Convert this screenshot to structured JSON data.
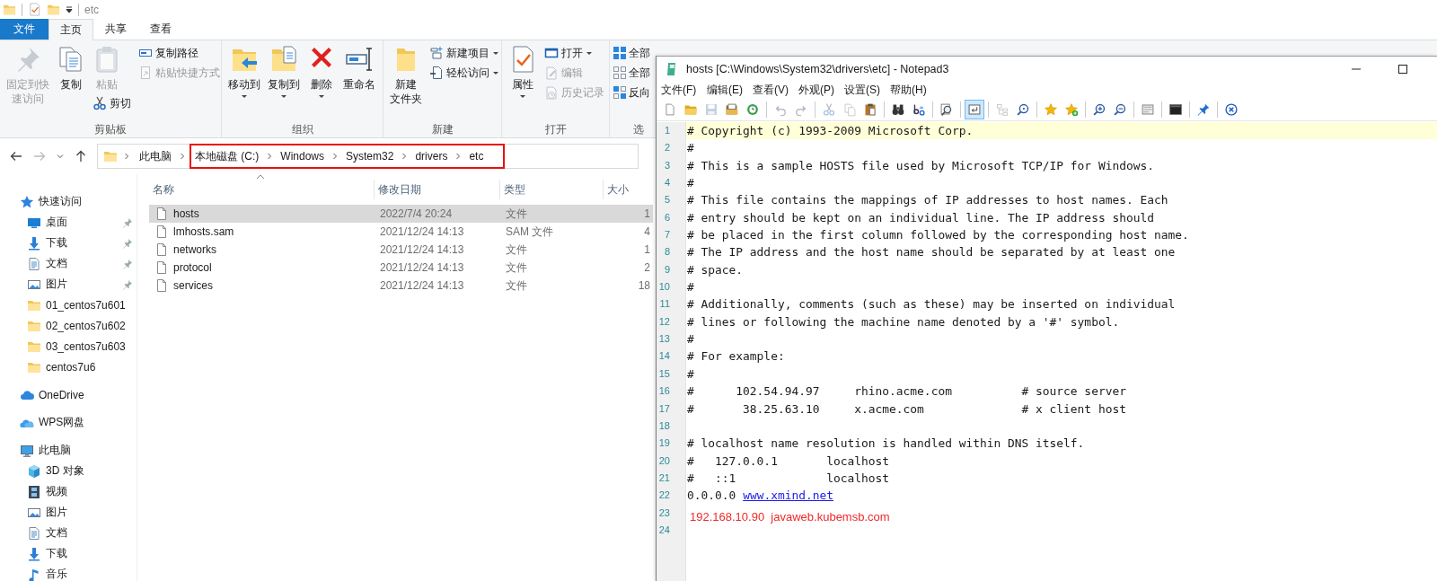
{
  "explorer": {
    "title": "etc",
    "tabs": [
      {
        "label": "文件",
        "kind": "file",
        "selected": false
      },
      {
        "label": "主页",
        "kind": "tab",
        "selected": true
      },
      {
        "label": "共享",
        "kind": "tab",
        "selected": false
      },
      {
        "label": "查看",
        "kind": "tab",
        "selected": false
      }
    ],
    "ribbon": [
      {
        "label": "剪贴板",
        "columns": [
          [
            {
              "label": "固定到快",
              "label_line2": "速访问",
              "kind": "pin",
              "large": true,
              "disabled": true,
              "dropdown": false
            }
          ],
          [
            {
              "label": "复制",
              "kind": "copy",
              "large": true,
              "disabled": false,
              "dropdown": false
            }
          ],
          [
            {
              "label": "粘贴",
              "kind": "paste",
              "large": true,
              "disabled": true,
              "dropdown": false
            },
            {
              "label": "剪切",
              "kind": "cut",
              "large": false,
              "disabled": false,
              "dropdown": false
            }
          ],
          [
            {
              "label": "复制路径",
              "kind": "copy-path",
              "large": false,
              "disabled": false,
              "dropdown": false
            },
            {
              "label": "粘贴快捷方式",
              "kind": "paste-shortcut",
              "large": false,
              "disabled": true,
              "dropdown": false
            }
          ]
        ]
      },
      {
        "label": "组织",
        "columns": [
          [
            {
              "label": "移动到",
              "kind": "move",
              "large": true,
              "disabled": false,
              "dropdown": true
            }
          ],
          [
            {
              "label": "复制到",
              "kind": "copyto",
              "large": true,
              "disabled": false,
              "dropdown": true
            }
          ],
          [
            {
              "label": "删除",
              "kind": "delete",
              "large": true,
              "disabled": false,
              "dropdown": true
            }
          ],
          [
            {
              "label": "重命名",
              "kind": "rename",
              "large": true,
              "disabled": false,
              "dropdown": false
            }
          ]
        ]
      },
      {
        "label": "新建",
        "columns": [
          [
            {
              "label": "新建",
              "label_line2": "文件夹",
              "kind": "new-folder",
              "large": true,
              "disabled": false,
              "dropdown": false
            }
          ],
          [
            {
              "label": "新建项目",
              "kind": "new-item",
              "large": false,
              "disabled": false,
              "dropdown": true
            },
            {
              "label": "轻松访问",
              "kind": "easy-access",
              "large": false,
              "disabled": false,
              "dropdown": true
            }
          ]
        ]
      },
      {
        "label": "打开",
        "columns": [
          [
            {
              "label": "属性",
              "kind": "properties",
              "large": true,
              "disabled": false,
              "dropdown": true
            }
          ],
          [
            {
              "label": "打开",
              "kind": "open",
              "large": false,
              "disabled": false,
              "dropdown": true
            },
            {
              "label": "编辑",
              "kind": "edit",
              "large": false,
              "disabled": true,
              "dropdown": false
            },
            {
              "label": "历史记录",
              "kind": "history",
              "large": false,
              "disabled": true,
              "dropdown": false
            }
          ]
        ]
      },
      {
        "label": "选",
        "columns": [
          [
            {
              "label": "全部",
              "kind": "select-all",
              "large": false,
              "disabled": false,
              "dropdown": false
            },
            {
              "label": "全部",
              "kind": "select-none",
              "large": false,
              "disabled": false,
              "dropdown": false
            },
            {
              "label": "反向",
              "kind": "invert",
              "large": false,
              "disabled": false,
              "dropdown": false
            }
          ]
        ]
      }
    ],
    "breadcrumbs": [
      {
        "label": "此电脑",
        "highlighted": false
      },
      {
        "label": "本地磁盘 (C:)",
        "highlighted": true
      },
      {
        "label": "Windows",
        "highlighted": true
      },
      {
        "label": "System32",
        "highlighted": true
      },
      {
        "label": "drivers",
        "highlighted": true
      },
      {
        "label": "etc",
        "highlighted": true
      }
    ],
    "sidebar": [
      {
        "label": "快速访问",
        "kind": "star",
        "children": [
          {
            "label": "桌面",
            "kind": "desktop",
            "pinned": true
          },
          {
            "label": "下载",
            "kind": "download",
            "pinned": true
          },
          {
            "label": "文档",
            "kind": "document",
            "pinned": true
          },
          {
            "label": "图片",
            "kind": "picture",
            "pinned": true
          },
          {
            "label": "01_centos7u601",
            "kind": "folder",
            "pinned": false
          },
          {
            "label": "02_centos7u602",
            "kind": "folder",
            "pinned": false
          },
          {
            "label": "03_centos7u603",
            "kind": "folder",
            "pinned": false
          },
          {
            "label": "centos7u6",
            "kind": "folder",
            "pinned": false
          }
        ]
      },
      {
        "label": "OneDrive",
        "kind": "cloud"
      },
      {
        "label": "WPS网盘",
        "kind": "cloud-wps"
      },
      {
        "label": "此电脑",
        "kind": "computer",
        "children": [
          {
            "label": "3D 对象",
            "kind": "cube"
          },
          {
            "label": "视频",
            "kind": "film"
          },
          {
            "label": "图片",
            "kind": "picture"
          },
          {
            "label": "文档",
            "kind": "document"
          },
          {
            "label": "下载",
            "kind": "download"
          },
          {
            "label": "音乐",
            "kind": "music"
          }
        ]
      }
    ],
    "columns": [
      "名称",
      "修改日期",
      "类型",
      "大小"
    ],
    "files": [
      {
        "name": "hosts",
        "date": "2022/7/4 20:24",
        "type": "文件",
        "size": "1",
        "selected": true
      },
      {
        "name": "lmhosts.sam",
        "date": "2021/12/24 14:13",
        "type": "SAM 文件",
        "size": "4",
        "selected": false
      },
      {
        "name": "networks",
        "date": "2021/12/24 14:13",
        "type": "文件",
        "size": "1",
        "selected": false
      },
      {
        "name": "protocol",
        "date": "2021/12/24 14:13",
        "type": "文件",
        "size": "2",
        "selected": false
      },
      {
        "name": "services",
        "date": "2021/12/24 14:13",
        "type": "文件",
        "size": "18",
        "selected": false
      }
    ]
  },
  "notepad": {
    "title": "hosts [C:\\Windows\\System32\\drivers\\etc] - Notepad3",
    "menu": [
      "文件(F)",
      "编辑(E)",
      "查看(V)",
      "外观(P)",
      "设置(S)",
      "帮助(H)"
    ],
    "toolbar": [
      {
        "kind": "new",
        "disabled": false,
        "on": false
      },
      {
        "kind": "open",
        "disabled": false,
        "on": false
      },
      {
        "kind": "save",
        "disabled": true,
        "on": false
      },
      {
        "kind": "saveas",
        "disabled": false,
        "on": false
      },
      {
        "kind": "revert",
        "disabled": false,
        "on": false
      },
      {
        "kind": "separator"
      },
      {
        "kind": "undo",
        "disabled": true,
        "on": false
      },
      {
        "kind": "redo",
        "disabled": true,
        "on": false
      },
      {
        "kind": "separator"
      },
      {
        "kind": "cut",
        "disabled": true,
        "on": false
      },
      {
        "kind": "copy",
        "disabled": true,
        "on": false
      },
      {
        "kind": "paste",
        "disabled": false,
        "on": false
      },
      {
        "kind": "separator"
      },
      {
        "kind": "find",
        "disabled": false,
        "on": false
      },
      {
        "kind": "replace",
        "disabled": false,
        "on": false
      },
      {
        "kind": "separator"
      },
      {
        "kind": "goto",
        "disabled": false,
        "on": false
      },
      {
        "kind": "separator"
      },
      {
        "kind": "wrap",
        "disabled": false,
        "on": true
      },
      {
        "kind": "separator"
      },
      {
        "kind": "tree",
        "disabled": true,
        "on": false
      },
      {
        "kind": "zoom-find",
        "disabled": false,
        "on": false
      },
      {
        "kind": "separator"
      },
      {
        "kind": "star",
        "disabled": false,
        "on": false
      },
      {
        "kind": "star-add",
        "disabled": false,
        "on": false
      },
      {
        "kind": "separator"
      },
      {
        "kind": "zoom-in",
        "disabled": false,
        "on": false
      },
      {
        "kind": "zoom-out",
        "disabled": false,
        "on": false
      },
      {
        "kind": "separator"
      },
      {
        "kind": "view",
        "disabled": false,
        "on": false
      },
      {
        "kind": "separator"
      },
      {
        "kind": "terminal",
        "disabled": false,
        "on": false
      },
      {
        "kind": "separator"
      },
      {
        "kind": "pin",
        "disabled": false,
        "on": false
      },
      {
        "kind": "separator"
      },
      {
        "kind": "close",
        "disabled": false,
        "on": false
      }
    ],
    "lines": [
      {
        "number": "1",
        "kind": "code",
        "current": true,
        "text": "# Copyright (c) 1993-2009 Microsoft Corp."
      },
      {
        "number": "2",
        "kind": "code",
        "current": false,
        "text": "#"
      },
      {
        "number": "3",
        "kind": "code",
        "current": false,
        "text": "# This is a sample HOSTS file used by Microsoft TCP/IP for Windows."
      },
      {
        "number": "4",
        "kind": "code",
        "current": false,
        "text": "#"
      },
      {
        "number": "5",
        "kind": "code",
        "current": false,
        "text": "# This file contains the mappings of IP addresses to host names. Each"
      },
      {
        "number": "6",
        "kind": "code",
        "current": false,
        "text": "# entry should be kept on an individual line. The IP address should"
      },
      {
        "number": "7",
        "kind": "code",
        "current": false,
        "text": "# be placed in the first column followed by the corresponding host name."
      },
      {
        "number": "8",
        "kind": "code",
        "current": false,
        "text": "# The IP address and the host name should be separated by at least one"
      },
      {
        "number": "9",
        "kind": "code",
        "current": false,
        "text": "# space."
      },
      {
        "number": "10",
        "kind": "code",
        "current": false,
        "text": "#"
      },
      {
        "number": "11",
        "kind": "code",
        "current": false,
        "text": "# Additionally, comments (such as these) may be inserted on individual"
      },
      {
        "number": "12",
        "kind": "code",
        "current": false,
        "text": "# lines or following the machine name denoted by a '#' symbol."
      },
      {
        "number": "13",
        "kind": "code",
        "current": false,
        "text": "#"
      },
      {
        "number": "14",
        "kind": "code",
        "current": false,
        "text": "# For example:"
      },
      {
        "number": "15",
        "kind": "code",
        "current": false,
        "text": "#"
      },
      {
        "number": "16",
        "kind": "code",
        "current": false,
        "text": "#      102.54.94.97     rhino.acme.com          # source server"
      },
      {
        "number": "17",
        "kind": "code",
        "current": false,
        "text": "#       38.25.63.10     x.acme.com              # x client host"
      },
      {
        "number": "18",
        "kind": "code",
        "current": false
      },
      {
        "number": "19",
        "kind": "code",
        "current": false,
        "text": "# localhost name resolution is handled within DNS itself."
      },
      {
        "number": "20",
        "kind": "code",
        "current": false,
        "text": "#   127.0.0.1       localhost"
      },
      {
        "number": "21",
        "kind": "code",
        "current": false,
        "text": "#   ::1             localhost"
      },
      {
        "number": "22",
        "kind": "link",
        "current": false,
        "text": "0.0.0.0",
        "link": "www.xmind.net"
      },
      {
        "number": "23",
        "kind": "annotation",
        "current": false,
        "text": "192.168.10.90  javaweb.kubemsb.com"
      },
      {
        "number": "24",
        "kind": "code",
        "current": false
      }
    ]
  }
}
